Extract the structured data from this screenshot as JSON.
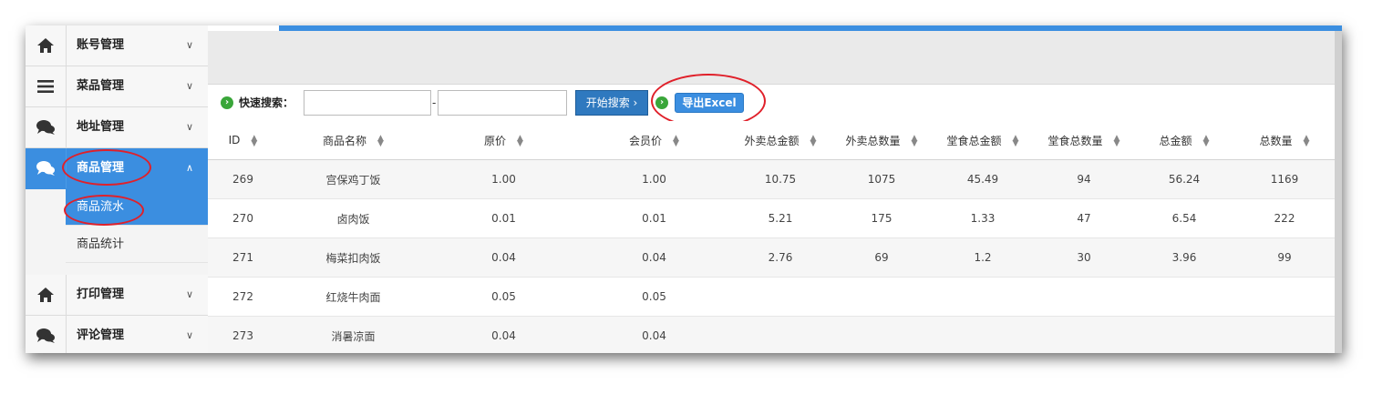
{
  "sidebar": {
    "items": [
      {
        "label": "账号管理",
        "icon": "home-icon",
        "chevron": "∨"
      },
      {
        "label": "菜品管理",
        "icon": "menu-lines-icon",
        "chevron": "∨"
      },
      {
        "label": "地址管理",
        "icon": "chat-bubbles-icon",
        "chevron": "∨"
      },
      {
        "label": "商品管理",
        "icon": "chat-bubbles-icon",
        "chevron": "∧",
        "active": true
      },
      {
        "label": "打印管理",
        "icon": "home-icon",
        "chevron": "∨"
      },
      {
        "label": "评论管理",
        "icon": "chat-bubbles-icon",
        "chevron": "∨"
      }
    ],
    "subitems": [
      {
        "label": "商品流水",
        "active": true
      },
      {
        "label": "商品统计"
      }
    ]
  },
  "search": {
    "label": "快速搜索：",
    "start_value": "",
    "end_value": "",
    "separator": "-",
    "search_button": "开始搜索 ›",
    "export_button": "导出Excel"
  },
  "table": {
    "columns": [
      "ID",
      "商品名称",
      "原价",
      "会员价",
      "外卖总金额",
      "外卖总数量",
      "堂食总金额",
      "堂食总数量",
      "总金额",
      "总数量"
    ],
    "rows": [
      [
        "269",
        "宫保鸡丁饭",
        "1.00",
        "1.00",
        "10.75",
        "1075",
        "45.49",
        "94",
        "56.24",
        "1169"
      ],
      [
        "270",
        "卤肉饭",
        "0.01",
        "0.01",
        "5.21",
        "175",
        "1.33",
        "47",
        "6.54",
        "222"
      ],
      [
        "271",
        "梅菜扣肉饭",
        "0.04",
        "0.04",
        "2.76",
        "69",
        "1.2",
        "30",
        "3.96",
        "99"
      ],
      [
        "272",
        "红烧牛肉面",
        "0.05",
        "0.05",
        "",
        "",
        "",
        "",
        "",
        ""
      ],
      [
        "273",
        "消暑凉面",
        "0.04",
        "0.04",
        "",
        "",
        "",
        "",
        "",
        ""
      ]
    ]
  },
  "colors": {
    "accent": "#3b8ee0",
    "annotation": "#e0202a",
    "go_icon": "#3aa63a"
  }
}
